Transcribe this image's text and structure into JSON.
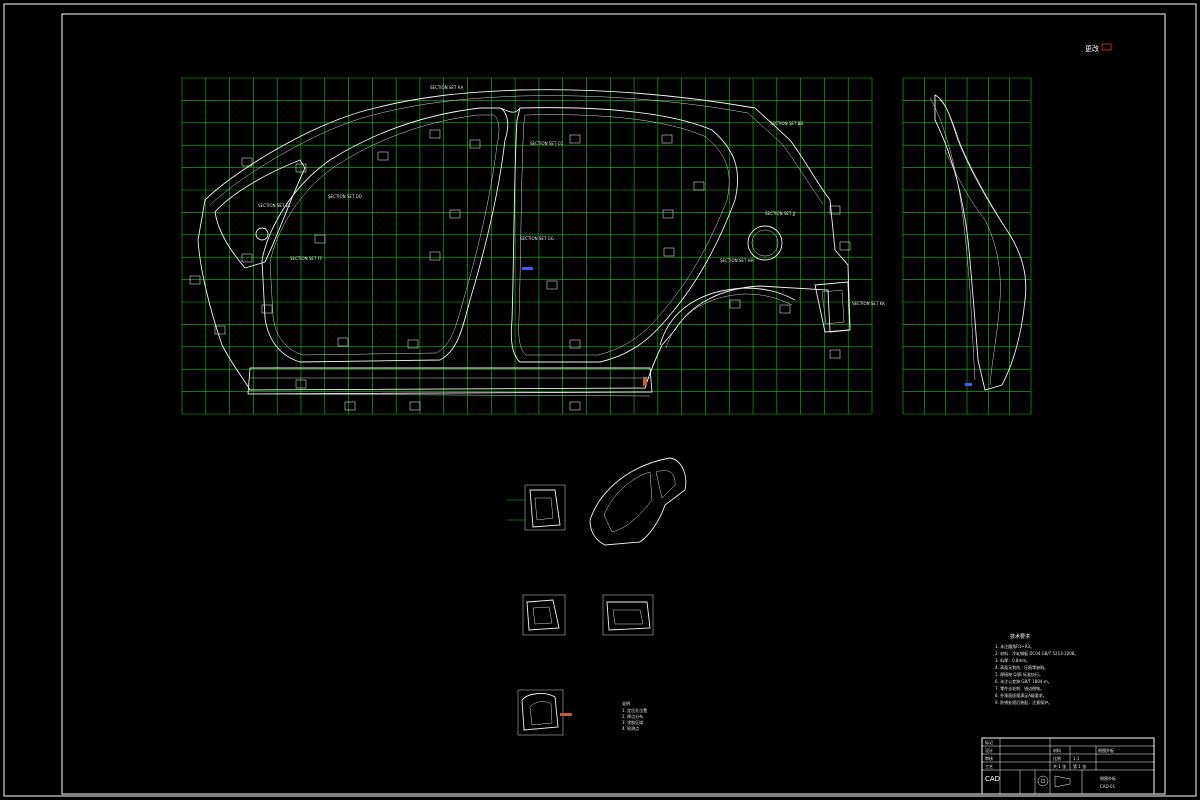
{
  "drawing": {
    "corner_mark": "更改",
    "logo": "CAD",
    "side_view": {
      "grid_cols": 29,
      "grid_rows": 15
    },
    "rear_view": {
      "grid_cols": 6,
      "grid_rows": 15
    },
    "section_callouts": [
      "SECTION SET AA",
      "SECTION SET BB",
      "SECTION SET CC",
      "SECTION SET DD",
      "SECTION SET EE",
      "SECTION SET FF",
      "SECTION SET GG",
      "SECTION SET HH",
      "SECTION SET JJ",
      "SECTION SET KK"
    ],
    "tech_requirements": {
      "title": "技术要求",
      "lines": [
        "1. 未注圆角R1~R3。",
        "2. 材料：冷轧钢板 DC04 GB/T 5213-2008。",
        "3. 料厚：0.8mm。",
        "4. 表面无划伤、压痕等缺陷。",
        "5. 焊接按 Q/JB 标准执行。",
        "6. 未注公差按 GB/T 1804-m。",
        "7. 零件去毛刺、锐边倒钝。",
        "8. 外观面质量满足A级要求。",
        "9. 防锈处理后装配，注意保护。"
      ]
    },
    "title_block": {
      "rows": [
        [
          "标记",
          "",
          "",
          "",
          ""
        ],
        [
          "设计",
          "",
          "材料",
          "",
          "侧围外板"
        ],
        [
          "审核",
          "",
          "比例",
          "1:1",
          ""
        ],
        [
          "工艺",
          "",
          "",
          "",
          ""
        ],
        [
          "批准",
          "",
          "共 1 张",
          "第 1 张",
          ""
        ]
      ],
      "part_name": "侧围外板",
      "drawing_no": "CAD-01"
    },
    "notes_small": {
      "title": "说明",
      "lines": [
        "1. 定位孔位置",
        "2. 焊点分布",
        "3. 涂胶区域",
        "4. 检测点"
      ]
    }
  }
}
